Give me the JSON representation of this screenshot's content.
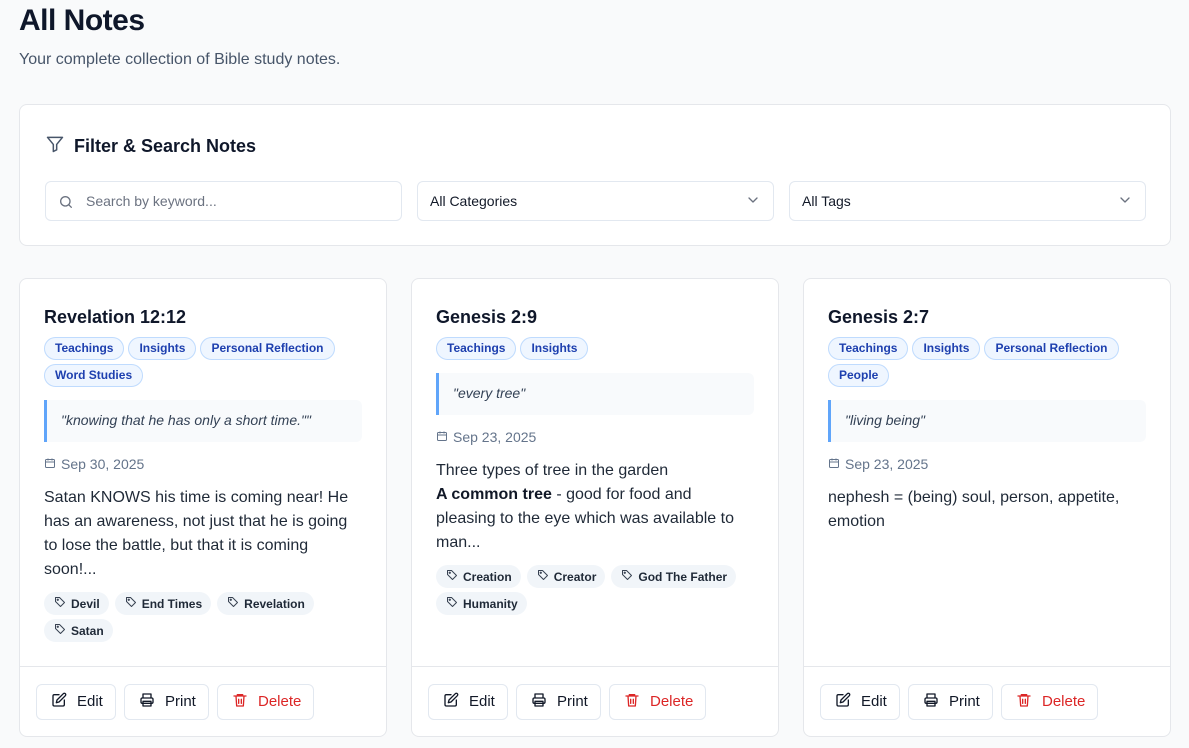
{
  "header": {
    "title": "All Notes",
    "subtitle": "Your complete collection of Bible study notes."
  },
  "filter": {
    "title": "Filter & Search Notes",
    "search_placeholder": "Search by keyword...",
    "category_selected": "All Categories",
    "tag_selected": "All Tags"
  },
  "notes": [
    {
      "title": "Revelation 12:12",
      "categories": [
        "Teachings",
        "Insights",
        "Personal Reflection",
        "Word Studies"
      ],
      "quote": "\"knowing that he has only a short time.\"\"",
      "date": "Sep 30, 2025",
      "text_lead": "",
      "text_body": "Satan KNOWS his time is coming near! He has an awareness, not just that he is going to lose the battle, but that it is coming soon!...",
      "tags": [
        "Devil",
        "End Times",
        "Revelation",
        "Satan"
      ]
    },
    {
      "title": "Genesis 2:9",
      "categories": [
        "Teachings",
        "Insights"
      ],
      "quote": "\"every tree\"",
      "date": "Sep 23, 2025",
      "text_line1": "Three types of tree in the garden",
      "text_bold": "A common tree",
      "text_rest": " - good for food and pleasing to the eye which was available to man...",
      "tags": [
        "Creation",
        "Creator",
        "God The Father",
        "Humanity"
      ]
    },
    {
      "title": "Genesis 2:7",
      "categories": [
        "Teachings",
        "Insights",
        "Personal Reflection",
        "People"
      ],
      "quote": "\"living being\"",
      "date": "Sep 23, 2025",
      "text_body": "nephesh = (being) soul, person, appetite, emotion",
      "tags": []
    }
  ],
  "actions": {
    "edit": "Edit",
    "print": "Print",
    "delete": "Delete"
  },
  "icons": {
    "filter": "filter-icon",
    "search": "search-icon",
    "chevron": "chevron-down-icon",
    "calendar": "calendar-icon",
    "tag": "tag-icon",
    "edit": "edit-icon",
    "print": "printer-icon",
    "delete": "trash-icon"
  },
  "colors": {
    "accent": "#1e40af",
    "quote_border": "#60a5fa",
    "danger": "#dc2626"
  }
}
